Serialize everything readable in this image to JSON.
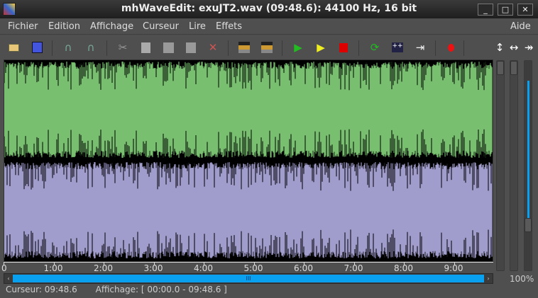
{
  "window": {
    "title": "mhWaveEdit: exuJT2.wav (09:48.6): 44100 Hz, 16 bit",
    "minimize": "_",
    "maximize": "□",
    "close": "✕"
  },
  "menu": {
    "items": [
      "Fichier",
      "Edition",
      "Affichage",
      "Curseur",
      "Lire",
      "Effets"
    ],
    "help": "Aide"
  },
  "toolbar": {
    "icons": [
      "open-icon",
      "save-icon",
      "undo-icon",
      "redo-icon",
      "cut-icon",
      "copy-icon",
      "paste-icon",
      "paste-over-icon",
      "delete-icon",
      "crop-icon",
      "silence-icon",
      "play-icon",
      "play-selection-icon",
      "stop-icon",
      "loop-icon",
      "follow-icon",
      "bounce-icon",
      "record-icon"
    ],
    "arrows": [
      "↕",
      "↔",
      "↠"
    ]
  },
  "colors": {
    "left_channel": "#78c070",
    "right_channel": "#a09ccc",
    "accent": "#0aa0f0"
  },
  "ruler": {
    "ticks": [
      "0",
      "1:00",
      "2:00",
      "3:00",
      "4:00",
      "5:00",
      "6:00",
      "7:00",
      "8:00",
      "9:00"
    ]
  },
  "scrollbar": {
    "grip": "III"
  },
  "zoom": {
    "level": "100%"
  },
  "status": {
    "cursor": "Curseur: 09:48.6",
    "view": "Affichage: [ 00:00.0 - 09:48.6 ]"
  }
}
